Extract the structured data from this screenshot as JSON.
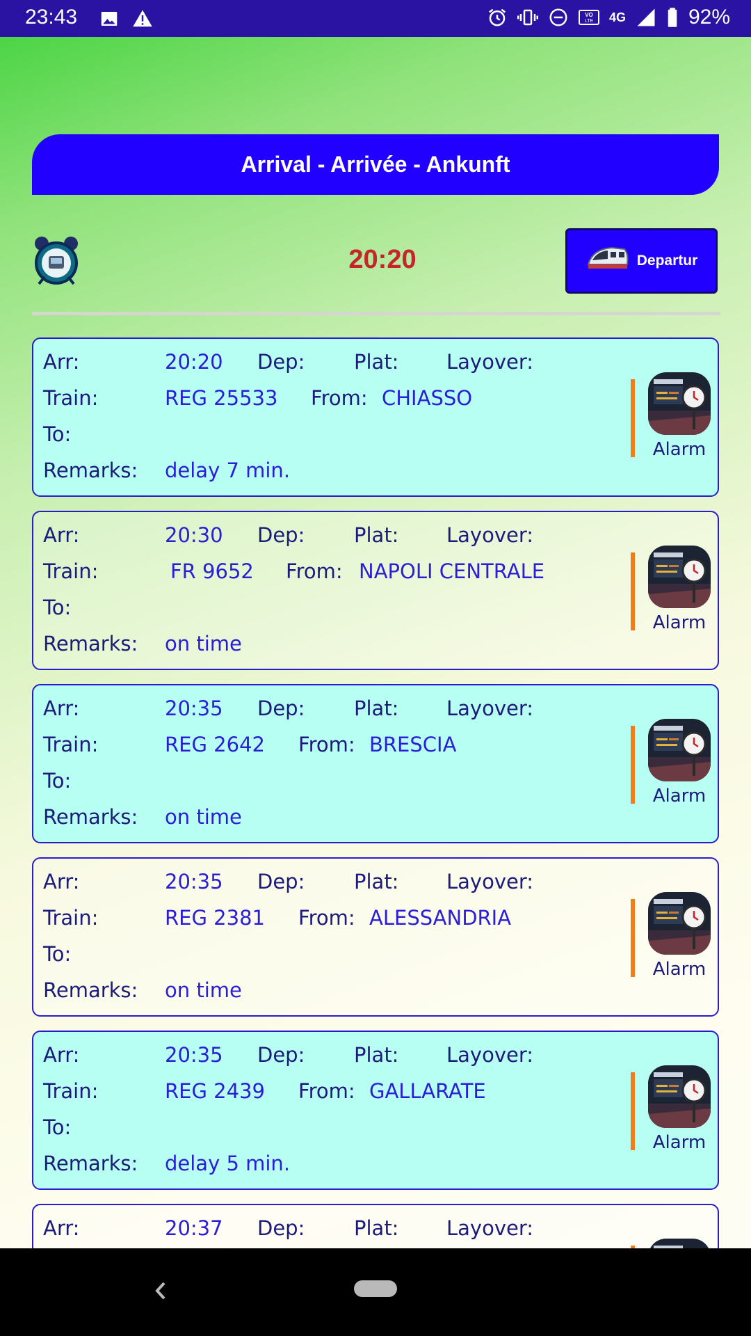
{
  "status_bar": {
    "time": "23:43",
    "left_icons": [
      "image-icon",
      "warning-icon"
    ],
    "right_icons": [
      "alarm-icon",
      "vibrate-icon",
      "dnd-icon",
      "volte-icon",
      "network-4g-icon",
      "signal-icon",
      "battery-icon"
    ],
    "network": "4G",
    "volte": "VoLTE",
    "battery": "92%"
  },
  "header": {
    "title": "Arrival - Arrivée - Ankunft"
  },
  "controls": {
    "alarm_clock_icon": "alarm-clock-icon",
    "current_time": "20:20",
    "departure_button_label": "Departur",
    "departure_button_icon": "train-icon"
  },
  "labels": {
    "arr": "Arr:",
    "dep": "Dep:",
    "plat": "Plat:",
    "layover": "Layover:",
    "train": "Train:",
    "from": "From:",
    "to": "To:",
    "remarks": "Remarks:",
    "alarm": "Alarm"
  },
  "arrivals": [
    {
      "arr": "20:20",
      "train": "REG 25533",
      "from": "CHIASSO",
      "remarks": "delay 7 min.",
      "highlight": true
    },
    {
      "arr": "20:30",
      "train": "FR 9652",
      "from": "NAPOLI CENTRALE",
      "remarks": "on time",
      "highlight": false
    },
    {
      "arr": "20:35",
      "train": "REG 2642",
      "from": "BRESCIA",
      "remarks": "on time",
      "highlight": true
    },
    {
      "arr": "20:35",
      "train": "REG 2381",
      "from": "ALESSANDRIA",
      "remarks": "on time",
      "highlight": false
    },
    {
      "arr": "20:35",
      "train": "REG 2439",
      "from": "GALLARATE",
      "remarks": "delay 5 min.",
      "highlight": true
    },
    {
      "arr": "20:37",
      "train": "",
      "from": "",
      "remarks": "",
      "highlight": false
    }
  ],
  "colors": {
    "status_bar": "#2a12a3",
    "banner": "#2200ff",
    "time": "#c4262b",
    "card_highlight": "#b6fff2",
    "card_border": "#2a1bcc",
    "accent_bar": "#f07d19"
  },
  "nav_bar": {
    "icons": [
      "back-icon",
      "home-pill-icon"
    ]
  }
}
